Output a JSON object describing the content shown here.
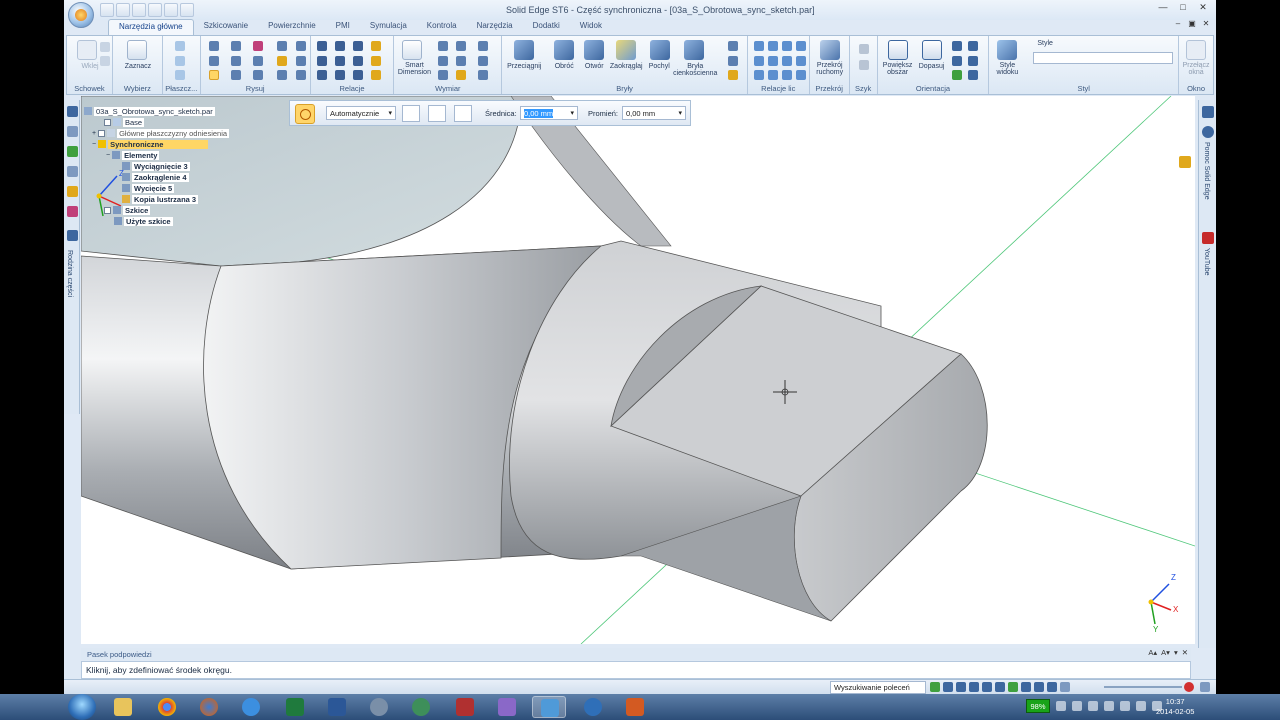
{
  "window": {
    "title": "Solid Edge ST6 - Część synchroniczna - [03a_S_Obrotowa_sync_sketch.par]"
  },
  "tabs": [
    "Narzędzia główne",
    "Szkicowanie",
    "Powierzchnie",
    "PMI",
    "Symulacja",
    "Kontrola",
    "Narzędzia",
    "Dodatki",
    "Widok"
  ],
  "active_tab": "Narzędzia główne",
  "ribbon": {
    "groups": [
      "Schowek",
      "Wybierz",
      "Płaszcz...",
      "Rysuj",
      "Relacje",
      "Wymiar",
      "Bryły",
      "Relacje lic",
      "Przekrój",
      "Szyk",
      "Orientacja",
      "Styl",
      "Okno"
    ],
    "buttons": {
      "wklej": "Wklej",
      "zaznacz": "Zaznacz",
      "smart_dimension": "Smart\nDimension",
      "przeciagnij": "Przeciągnij",
      "obroc": "Obróć",
      "otworz": "Otwór",
      "zaokraglaj": "Zaokrąglaj",
      "pochyl": "Pochyl",
      "bryla": "Bryła\ncienkościenna",
      "przekroj": "Przekrój\nruchomy",
      "powieksz": "Powiększ\nobszar",
      "dopasuj": "Dopasuj",
      "style_widoku": "Style\nwidoku",
      "przelacz": "Przełącz\nokna"
    },
    "style_label": "Style"
  },
  "command_bar": {
    "mode": "Automatycznie",
    "diameter_label": "Średnica:",
    "diameter_value": "0,00 mm",
    "radius_label": "Promień:",
    "radius_value": "0,00 mm"
  },
  "pathfinder": {
    "file": "03a_S_Obrotowa_sync_sketch.par",
    "base": "Base",
    "planes": "Główne płaszczyzny odniesienia",
    "synchronous": "Synchroniczne",
    "features": "Elementy",
    "items": [
      "Wyciągnięcie 3",
      "Zaokrąglenie 4",
      "Wycięcie 5",
      "Kopia lustrzana 3"
    ],
    "sketches": "Szkice",
    "used_sketches": "Użyte szkice"
  },
  "side_labels": {
    "family": "Rodzina części",
    "help": "Pomoc Solid Edge",
    "youtube": "YouTube"
  },
  "prompt": {
    "title": "Pasek podpowiedzi",
    "text": "Kliknij, aby zdefiniować środek okręgu."
  },
  "status": {
    "command_search": "Wyszukiwanie poleceń"
  },
  "taskbar": {
    "battery": "98%",
    "time": "10:37",
    "date": "2014-02-05"
  },
  "colors": {
    "ribbon_bg": "#dbe7f4",
    "selected_highlight": "#ffd665",
    "axis_x": "#e02020",
    "axis_y": "#20a020",
    "axis_z": "#2050e0"
  }
}
